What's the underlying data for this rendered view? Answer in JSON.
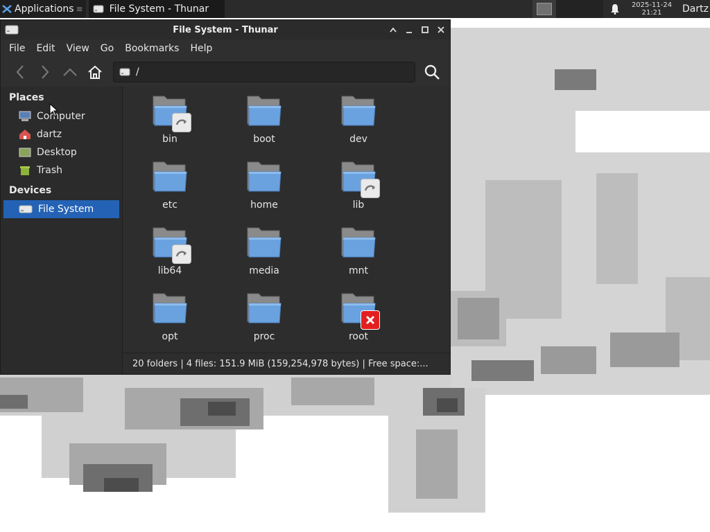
{
  "panel": {
    "applications_label": "Applications",
    "task_title": "File System - Thunar",
    "clock_date": "2025-11-24",
    "clock_time": "21:21",
    "user": "Dartz"
  },
  "window": {
    "title": "File System - Thunar",
    "menu": [
      "File",
      "Edit",
      "View",
      "Go",
      "Bookmarks",
      "Help"
    ],
    "location_path": "/"
  },
  "sidebar": {
    "places_header": "Places",
    "places": [
      {
        "label": "Computer",
        "icon": "computer-icon"
      },
      {
        "label": "dartz",
        "icon": "home-folder-icon"
      },
      {
        "label": "Desktop",
        "icon": "desktop-icon"
      },
      {
        "label": "Trash",
        "icon": "trash-icon"
      }
    ],
    "devices_header": "Devices",
    "devices": [
      {
        "label": "File System",
        "icon": "drive-icon",
        "selected": true
      }
    ]
  },
  "files": [
    {
      "name": "bin",
      "emblem": "symlink"
    },
    {
      "name": "boot",
      "emblem": ""
    },
    {
      "name": "dev",
      "emblem": ""
    },
    {
      "name": "etc",
      "emblem": ""
    },
    {
      "name": "home",
      "emblem": ""
    },
    {
      "name": "lib",
      "emblem": "symlink"
    },
    {
      "name": "lib64",
      "emblem": "symlink"
    },
    {
      "name": "media",
      "emblem": ""
    },
    {
      "name": "mnt",
      "emblem": ""
    },
    {
      "name": "opt",
      "emblem": ""
    },
    {
      "name": "proc",
      "emblem": ""
    },
    {
      "name": "root",
      "emblem": "no-access"
    }
  ],
  "status": "20 folders  |  4 files: 151.9 MiB (159,254,978 bytes)  |  Free space:...",
  "colors": {
    "selection": "#2462b5",
    "folder_front": "#6aa2e0",
    "folder_back": "#8a8a8a"
  }
}
